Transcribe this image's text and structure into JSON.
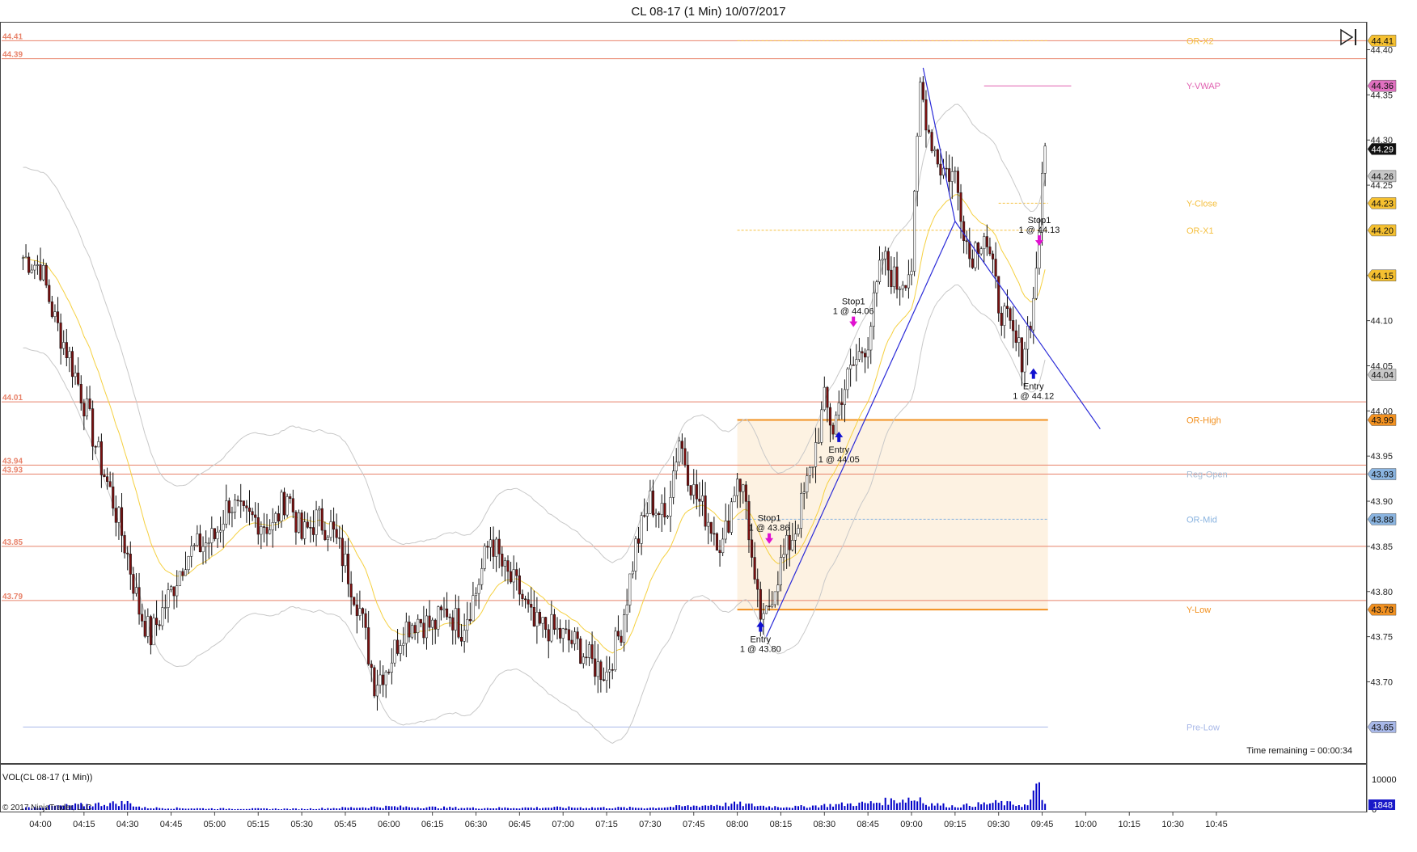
{
  "window": {
    "title": "CL 08-17 (1 Min)  10/07/2017"
  },
  "price_panel": {
    "right_axis_ticks": [
      "44.40",
      "44.35",
      "44.30",
      "44.25",
      "44.15",
      "44.10",
      "44.05",
      "44.00",
      "43.95",
      "43.90",
      "43.85",
      "43.80",
      "43.75",
      "43.70"
    ],
    "time_remaining": "Time remaining = 00:00:34"
  },
  "volume_panel": {
    "label": "VOL(CL 08-17 (1 Min))",
    "axis_top": "10000",
    "axis_bottom": "0",
    "last_value": "1848",
    "copyright": "© 2017 NinjaTrader, LLC"
  },
  "colors": {
    "level_line": "#e8826a",
    "level_label": "#e8826a",
    "vwap": "#f5d040",
    "bands": "#c8c8c8",
    "trendline": "#2a2ad8",
    "candle_up": "#1a1a1a",
    "candle_down": "#7a1010",
    "volume": "#0000c8",
    "or_zone": "#fdf2e2",
    "or_line": "#f29120",
    "pre_low": "#a8b8e8",
    "entry_arrow": "#1010d0",
    "stop_arrow": "#e010d0"
  },
  "chart_data": {
    "type": "candlestick",
    "title": "CL 08-17 (1 Min)  10/07/2017",
    "x_tick_labels": [
      "04:00",
      "04:15",
      "04:30",
      "04:45",
      "05:00",
      "05:15",
      "05:30",
      "05:45",
      "06:00",
      "06:15",
      "06:30",
      "06:45",
      "07:00",
      "07:15",
      "07:30",
      "07:45",
      "08:00",
      "08:15",
      "08:30",
      "08:45",
      "09:00",
      "09:15",
      "09:30",
      "09:45",
      "10:00",
      "10:15",
      "10:30",
      "10:45"
    ],
    "ylim": [
      43.61,
      44.43
    ],
    "price_path": [
      [
        "03:54",
        44.17
      ],
      [
        "04:00",
        44.16
      ],
      [
        "04:05",
        44.1
      ],
      [
        "04:10",
        44.06
      ],
      [
        "04:15",
        44.01
      ],
      [
        "04:20",
        43.95
      ],
      [
        "04:25",
        43.9
      ],
      [
        "04:30",
        43.84
      ],
      [
        "04:34",
        43.78
      ],
      [
        "04:38",
        43.75
      ],
      [
        "04:45",
        43.8
      ],
      [
        "04:50",
        43.84
      ],
      [
        "05:00",
        43.86
      ],
      [
        "05:05",
        43.9
      ],
      [
        "05:10",
        43.88
      ],
      [
        "05:15",
        43.88
      ],
      [
        "05:20",
        43.87
      ],
      [
        "05:25",
        43.91
      ],
      [
        "05:30",
        43.86
      ],
      [
        "05:35",
        43.88
      ],
      [
        "05:40",
        43.87
      ],
      [
        "05:45",
        43.83
      ],
      [
        "05:50",
        43.78
      ],
      [
        "05:55",
        43.7
      ],
      [
        "06:00",
        43.72
      ],
      [
        "06:05",
        43.76
      ],
      [
        "06:10",
        43.77
      ],
      [
        "06:15",
        43.76
      ],
      [
        "06:20",
        43.78
      ],
      [
        "06:25",
        43.76
      ],
      [
        "06:30",
        43.8
      ],
      [
        "06:35",
        43.86
      ],
      [
        "06:40",
        43.82
      ],
      [
        "06:45",
        43.8
      ],
      [
        "06:50",
        43.76
      ],
      [
        "06:55",
        43.76
      ],
      [
        "07:00",
        43.75
      ],
      [
        "07:05",
        43.74
      ],
      [
        "07:10",
        43.72
      ],
      [
        "07:15",
        43.71
      ],
      [
        "07:20",
        43.76
      ],
      [
        "07:25",
        43.85
      ],
      [
        "07:30",
        43.9
      ],
      [
        "07:35",
        43.88
      ],
      [
        "07:40",
        43.97
      ],
      [
        "07:45",
        43.91
      ],
      [
        "07:50",
        43.88
      ],
      [
        "07:55",
        43.85
      ],
      [
        "08:00",
        43.93
      ],
      [
        "08:03",
        43.9
      ],
      [
        "08:06",
        43.8
      ],
      [
        "08:09",
        43.76
      ],
      [
        "08:12",
        43.8
      ],
      [
        "08:15",
        43.83
      ],
      [
        "08:20",
        43.87
      ],
      [
        "08:25",
        43.93
      ],
      [
        "08:30",
        44.01
      ],
      [
        "08:33",
        43.98
      ],
      [
        "08:36",
        44.02
      ],
      [
        "08:40",
        44.05
      ],
      [
        "08:45",
        44.08
      ],
      [
        "08:50",
        44.17
      ],
      [
        "08:55",
        44.14
      ],
      [
        "09:00",
        44.16
      ],
      [
        "09:03",
        44.36
      ],
      [
        "09:06",
        44.31
      ],
      [
        "09:10",
        44.27
      ],
      [
        "09:15",
        44.26
      ],
      [
        "09:20",
        44.17
      ],
      [
        "09:25",
        44.2
      ],
      [
        "09:30",
        44.12
      ],
      [
        "09:35",
        44.08
      ],
      [
        "09:38",
        44.06
      ],
      [
        "09:42",
        44.12
      ],
      [
        "09:46",
        44.29
      ]
    ],
    "volume_path": [
      [
        "03:54",
        700
      ],
      [
        "04:00",
        1100
      ],
      [
        "04:30",
        2600
      ],
      [
        "04:35",
        800
      ],
      [
        "05:00",
        500
      ],
      [
        "05:30",
        400
      ],
      [
        "06:00",
        1200
      ],
      [
        "06:30",
        700
      ],
      [
        "07:00",
        900
      ],
      [
        "07:30",
        800
      ],
      [
        "07:48",
        1600
      ],
      [
        "08:00",
        2200
      ],
      [
        "08:10",
        1300
      ],
      [
        "08:20",
        1100
      ],
      [
        "08:30",
        1700
      ],
      [
        "08:45",
        2400
      ],
      [
        "09:00",
        4100
      ],
      [
        "09:03",
        2600
      ],
      [
        "09:15",
        1300
      ],
      [
        "09:30",
        2600
      ],
      [
        "09:40",
        1600
      ],
      [
        "09:44",
        9000
      ],
      [
        "09:46",
        1848
      ]
    ],
    "horizontal_levels": [
      {
        "label": "44.41",
        "price": 44.41
      },
      {
        "label": "44.39",
        "price": 44.39
      },
      {
        "label": "44.01",
        "price": 44.01
      },
      {
        "label": "43.94",
        "price": 43.94
      },
      {
        "label": "43.93",
        "price": 43.93
      },
      {
        "label": "43.85",
        "price": 43.85
      },
      {
        "label": "43.79",
        "price": 43.79
      }
    ],
    "named_levels": [
      {
        "label": "OR-X2",
        "price": 44.41,
        "color": "#f5c040",
        "style": "dotted",
        "start": "08:00"
      },
      {
        "label": "Y-VWAP",
        "price": 44.36,
        "color": "#e060b0",
        "style": "solid",
        "start": "09:25"
      },
      {
        "label": "Y-Close",
        "price": 44.23,
        "color": "#f5c040",
        "style": "dotted",
        "start": "09:30"
      },
      {
        "label": "OR-X1",
        "price": 44.2,
        "color": "#f5c040",
        "style": "dotted",
        "start": "08:00"
      },
      {
        "label": "OR-High",
        "price": 43.99,
        "color": "#f29120",
        "style": "solid",
        "start": "08:00"
      },
      {
        "label": "Reg-Open",
        "price": 43.93,
        "color": "#a8c0d8",
        "style": "none",
        "start": "08:00"
      },
      {
        "label": "OR-Mid",
        "price": 43.88,
        "color": "#8ab4e0",
        "style": "dotted",
        "start": "08:00"
      },
      {
        "label": "Y-Low",
        "price": 43.78,
        "color": "#f29120",
        "style": "solid",
        "start": "08:00"
      },
      {
        "label": "Pre-Low",
        "price": 43.65,
        "color": "#a8b8e8",
        "style": "solid",
        "start": "03:54"
      }
    ],
    "axis_price_tags": [
      {
        "label": "44.41",
        "price": 44.41,
        "bg": "#f5c030",
        "fg": "#111"
      },
      {
        "label": "44.36",
        "price": 44.36,
        "bg": "#e070c0",
        "fg": "#111"
      },
      {
        "label": "44.29",
        "price": 44.29,
        "bg": "#111111",
        "fg": "#fff"
      },
      {
        "label": "44.26",
        "price": 44.26,
        "bg": "#c8c8c8",
        "fg": "#111"
      },
      {
        "label": "44.23",
        "price": 44.23,
        "bg": "#f5c030",
        "fg": "#111"
      },
      {
        "label": "44.20",
        "price": 44.2,
        "bg": "#f5c030",
        "fg": "#111"
      },
      {
        "label": "44.15",
        "price": 44.15,
        "bg": "#f5c030",
        "fg": "#111"
      },
      {
        "label": "44.04",
        "price": 44.04,
        "bg": "#c8c8c8",
        "fg": "#111"
      },
      {
        "label": "43.99",
        "price": 43.99,
        "bg": "#f29120",
        "fg": "#111"
      },
      {
        "label": "43.93",
        "price": 43.93,
        "bg": "#8ab4e0",
        "fg": "#111"
      },
      {
        "label": "43.88",
        "price": 43.88,
        "bg": "#8ab4e0",
        "fg": "#111"
      },
      {
        "label": "43.78",
        "price": 43.78,
        "bg": "#f29120",
        "fg": "#111"
      },
      {
        "label": "43.65",
        "price": 43.65,
        "bg": "#a8b8e8",
        "fg": "#111"
      }
    ],
    "trade_annotations": [
      {
        "time": "08:08",
        "price": 43.76,
        "label_1": "Entry",
        "label_2": "1 @ 43.80",
        "kind": "entry"
      },
      {
        "time": "08:11",
        "price": 43.86,
        "label_1": "Stop1",
        "label_2": "1 @ 43.86",
        "kind": "stop"
      },
      {
        "time": "08:35",
        "price": 43.97,
        "label_1": "Entry",
        "label_2": "1 @ 44.05",
        "kind": "entry"
      },
      {
        "time": "08:40",
        "price": 44.1,
        "label_1": "Stop1",
        "label_2": "1 @ 44.06",
        "kind": "stop"
      },
      {
        "time": "09:42",
        "price": 44.04,
        "label_1": "Entry",
        "label_2": "1 @ 44.12",
        "kind": "entry"
      },
      {
        "time": "09:44",
        "price": 44.19,
        "label_1": "Stop1",
        "label_2": "1 @ 44.13",
        "kind": "stop"
      }
    ],
    "trendlines": [
      {
        "from": [
          "08:10",
          43.75
        ],
        "to": [
          "09:15",
          44.21
        ]
      },
      {
        "from": [
          "09:04",
          44.38
        ],
        "to": [
          "09:15",
          44.21
        ]
      },
      {
        "from": [
          "09:15",
          44.21
        ],
        "to": [
          "10:05",
          43.98
        ]
      }
    ]
  }
}
